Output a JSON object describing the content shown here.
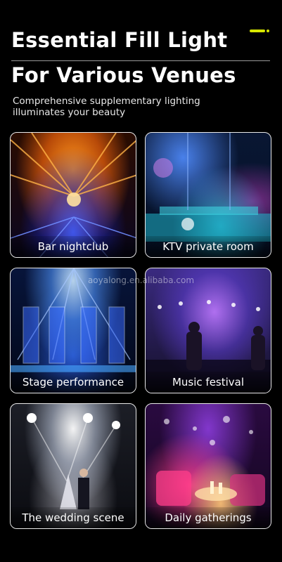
{
  "header": {
    "title_line1": "Essential Fill Light",
    "title_line2": "For Various Venues",
    "subtitle": "Comprehensive supplementary lighting illuminates your beauty",
    "accent_color": "#d7e600"
  },
  "venues": [
    {
      "label": "Bar nightclub"
    },
    {
      "label": "KTV private room"
    },
    {
      "label": "Stage performance"
    },
    {
      "label": "Music festival"
    },
    {
      "label": "The wedding scene"
    },
    {
      "label": "Daily gatherings"
    }
  ],
  "watermark": "aoyalong.en.alibaba.com"
}
